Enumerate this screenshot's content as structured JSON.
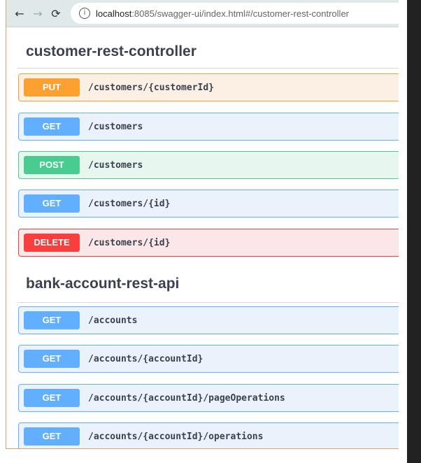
{
  "browser": {
    "url_host": "localhost",
    "url_rest": ":8085/swagger-ui/index.html#/customer-rest-controller"
  },
  "sections": [
    {
      "title": "customer-rest-controller",
      "operations": [
        {
          "method": "PUT",
          "path": "/customers/{customerId}"
        },
        {
          "method": "GET",
          "path": "/customers"
        },
        {
          "method": "POST",
          "path": "/customers"
        },
        {
          "method": "GET",
          "path": "/customers/{id}"
        },
        {
          "method": "DELETE",
          "path": "/customers/{id}"
        }
      ]
    },
    {
      "title": "bank-account-rest-api",
      "operations": [
        {
          "method": "GET",
          "path": "/accounts"
        },
        {
          "method": "GET",
          "path": "/accounts/{accountId}"
        },
        {
          "method": "GET",
          "path": "/accounts/{accountId}/pageOperations"
        },
        {
          "method": "GET",
          "path": "/accounts/{accountId}/operations"
        }
      ]
    }
  ],
  "colors": {
    "put": "#fca130",
    "get": "#61affe",
    "post": "#49cc90",
    "delete": "#f93e3e"
  }
}
